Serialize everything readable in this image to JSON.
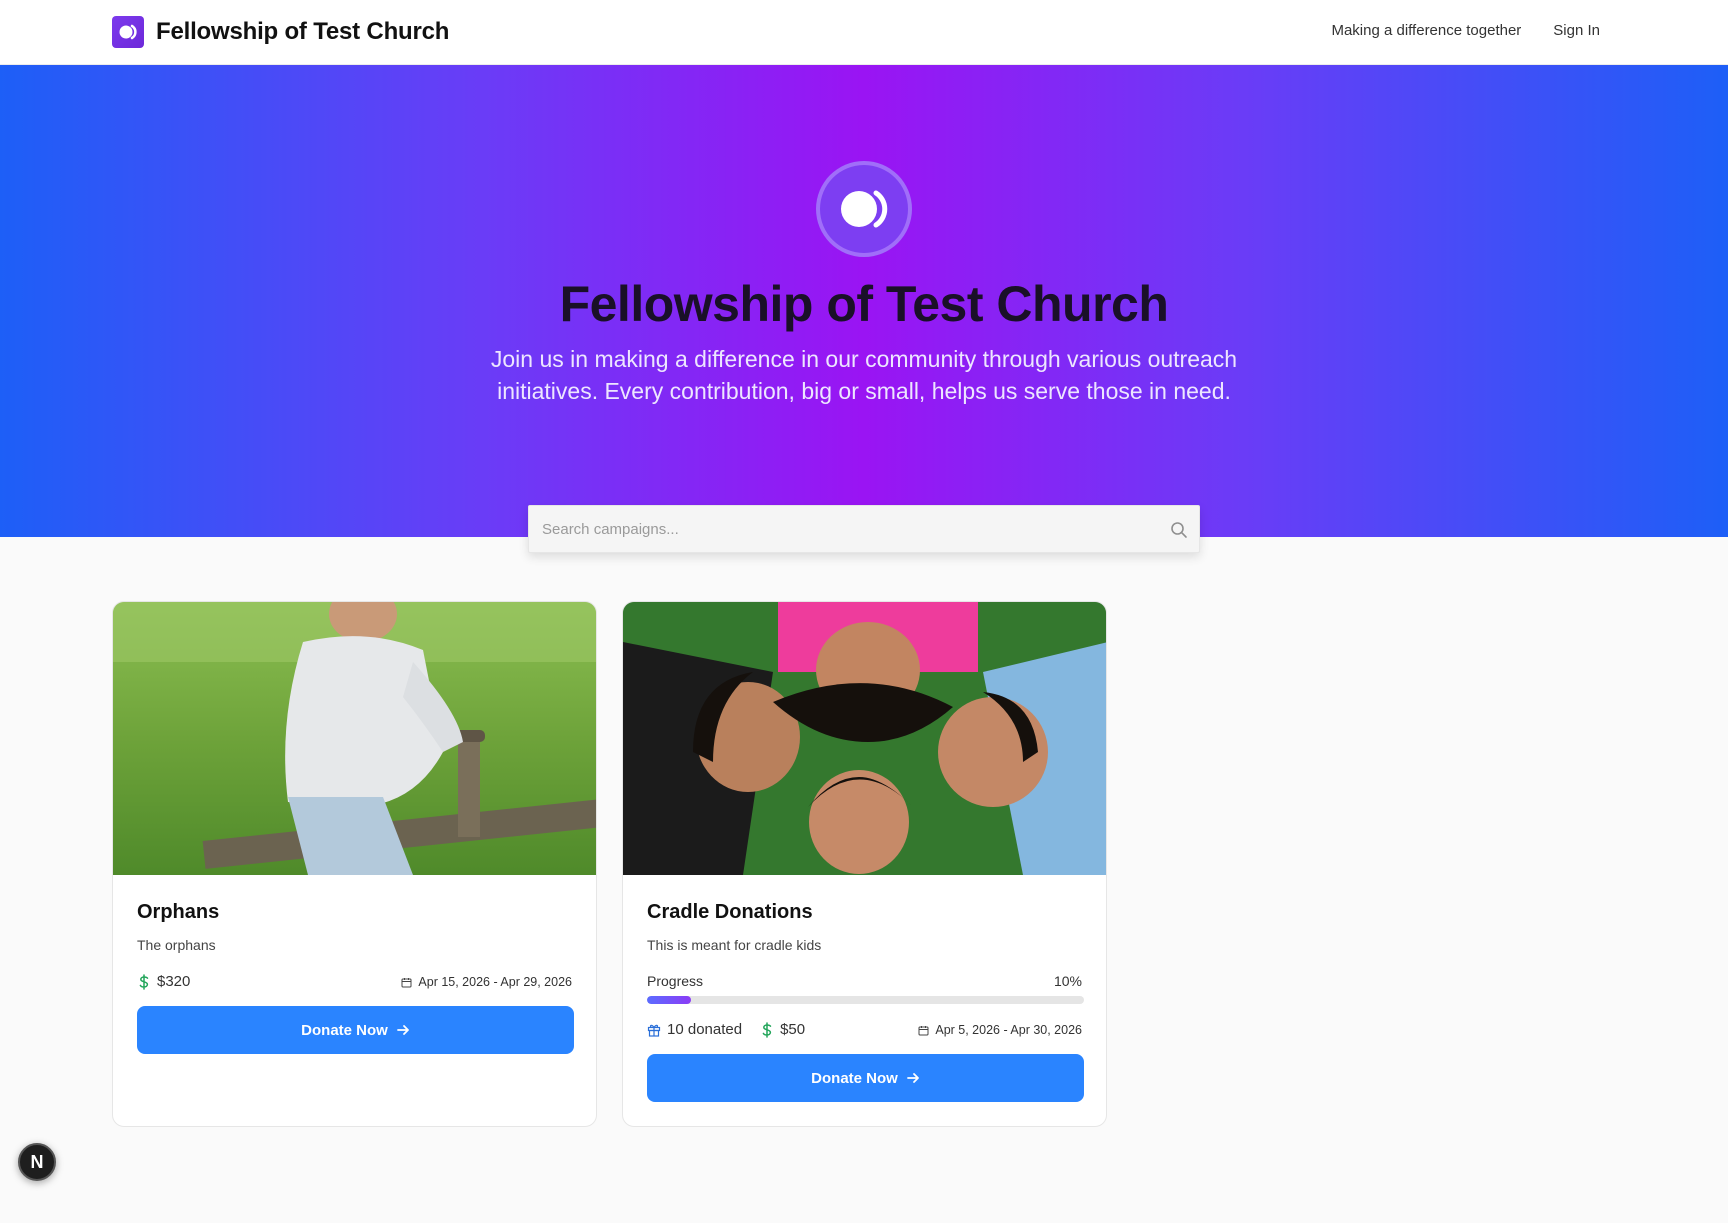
{
  "header": {
    "brand_name": "Fellowship of Test Church",
    "nav": {
      "tagline": "Making a difference together",
      "sign_in": "Sign In"
    }
  },
  "hero": {
    "title": "Fellowship of Test Church",
    "text": "Join us in making a difference in our community through various outreach initiatives. Every contribution, big or small, helps us serve those in need."
  },
  "search": {
    "placeholder": "Search campaigns...",
    "value": ""
  },
  "campaigns": [
    {
      "title": "Orphans",
      "description": "The orphans",
      "amount": "$320",
      "dates": "Apr 15, 2026 - Apr 29, 2026",
      "button": "Donate Now",
      "image": "child-on-seesaw-photo"
    },
    {
      "title": "Cradle Donations",
      "description": "This is meant for cradle kids",
      "progress_label": "Progress",
      "progress_text": "10%",
      "progress_value": 10,
      "donated": "10 donated",
      "amount": "$50",
      "dates": "Apr 5, 2026 - Apr 30, 2026",
      "button": "Donate Now",
      "image": "children-heads-together-photo"
    }
  ],
  "dev_badge": "N",
  "colors": {
    "brand": "#7c3aed",
    "button": "#2a84ff",
    "money_icon": "#22a55a",
    "hero_blue": "#1d5ff7",
    "hero_purple": "#9a14f3"
  }
}
